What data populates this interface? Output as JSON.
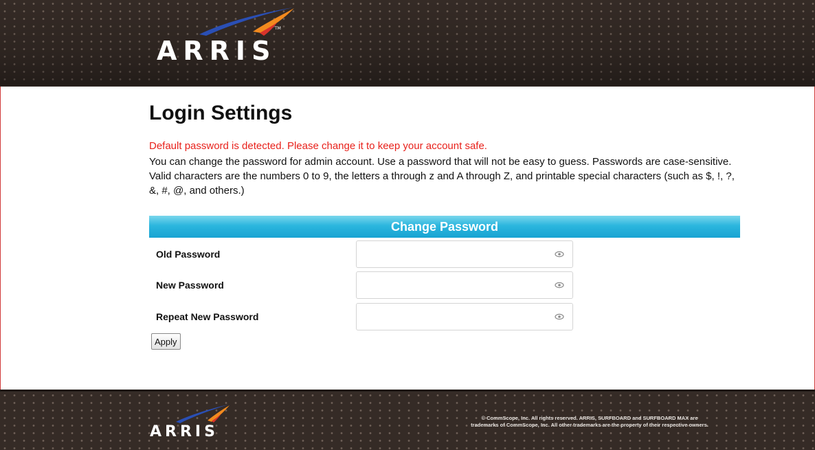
{
  "header": {
    "logo": {
      "text": "ARRIS",
      "trademark": "TM",
      "icon": "arris-swoosh-logo"
    }
  },
  "main": {
    "title": "Login Settings",
    "warning": "Default password is detected. Please change it to keep your account safe.",
    "description": "You can change the password for admin account. Use a password that will not be easy to guess. Passwords are case-sensitive. Valid characters are the numbers 0 to 9, the letters a through z and A through Z, and printable special characters (such as $, !, ?, &, #, @, and others.)",
    "section_title": "Change Password",
    "fields": [
      {
        "label": "Old Password",
        "value": "",
        "icon": "eye-icon"
      },
      {
        "label": "New Password",
        "value": "",
        "icon": "eye-icon"
      },
      {
        "label": "Repeat New Password",
        "value": "",
        "icon": "eye-icon"
      }
    ],
    "apply_label": "Apply"
  },
  "footer": {
    "logo": {
      "text": "ARRIS",
      "icon": "arris-swoosh-logo"
    },
    "copyright_line1": "© CommScope, Inc. All rights reserved. ARRIS, SURFBOARD and SURFBOARD MAX are",
    "copyright_line2": "trademarks of CommScope, Inc. All other trademarks are the property of their respective owners."
  },
  "colors": {
    "warning": "#e8211b",
    "banner": "#2bb6de",
    "header_bg": "#352b26",
    "swoosh_blue": "#2a4fb5",
    "swoosh_orange": "#f28a1e",
    "swoosh_red": "#d9332b"
  }
}
